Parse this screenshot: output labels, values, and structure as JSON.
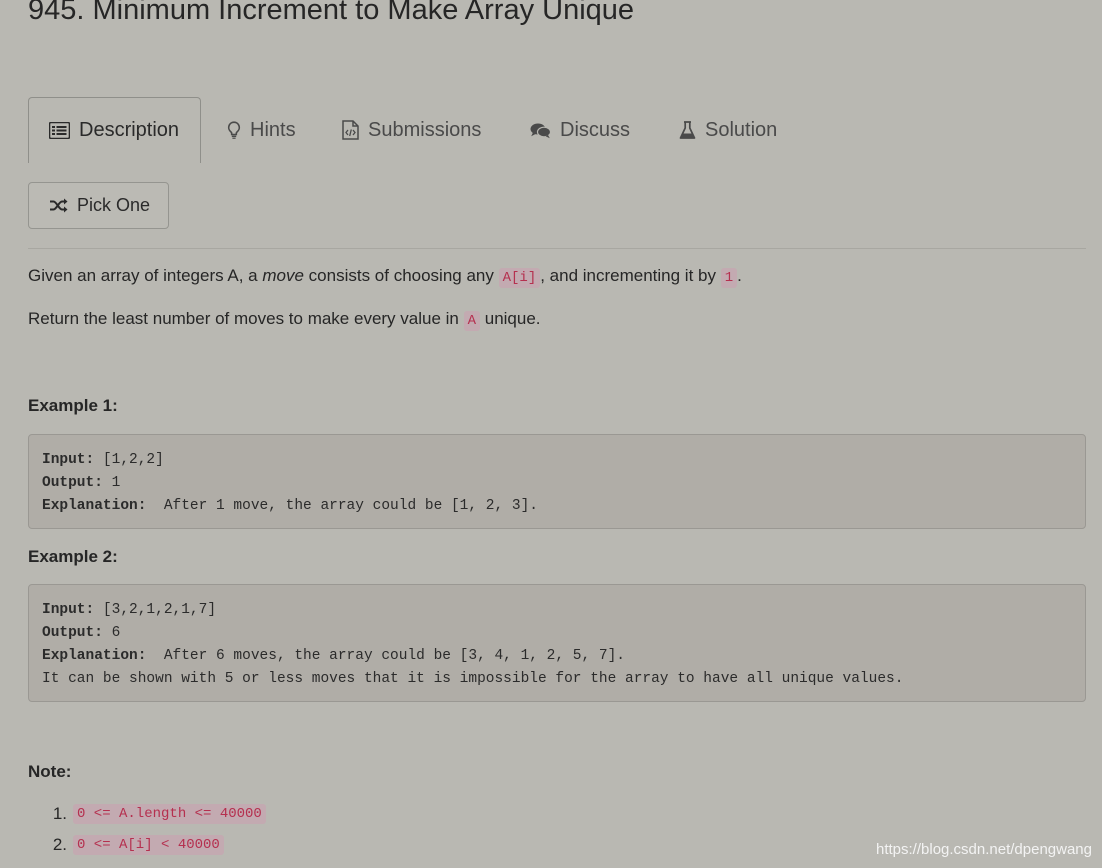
{
  "problem": {
    "title": "945. Minimum Increment to Make Array Unique"
  },
  "tabs": [
    {
      "label": "Description",
      "icon": "list-icon",
      "active": true
    },
    {
      "label": "Hints",
      "icon": "lightbulb-icon",
      "active": false
    },
    {
      "label": "Submissions",
      "icon": "code-file-icon",
      "active": false
    },
    {
      "label": "Discuss",
      "icon": "comments-icon",
      "active": false
    },
    {
      "label": "Solution",
      "icon": "flask-icon",
      "active": false
    }
  ],
  "pick_one": {
    "label": "Pick One",
    "icon": "shuffle-icon"
  },
  "description": {
    "line1_a": "Given an array of integers A, a ",
    "line1_em": "move",
    "line1_b": " consists of choosing any ",
    "line1_code1": "A[i]",
    "line1_c": ", and incrementing it by ",
    "line1_code2": "1",
    "line1_d": ".",
    "line2_a": "Return the least number of moves to make every value in ",
    "line2_code": "A",
    "line2_b": " unique."
  },
  "examples": [
    {
      "heading": "Example 1:",
      "input_label": "Input:",
      "input_value": " [1,2,2]",
      "output_label": "Output:",
      "output_value": " 1",
      "explanation_label": "Explanation:",
      "explanation_value": "  After 1 move, the array could be [1, 2, 3].",
      "extra": ""
    },
    {
      "heading": "Example 2:",
      "input_label": "Input:",
      "input_value": " [3,2,1,2,1,7]",
      "output_label": "Output:",
      "output_value": " 6",
      "explanation_label": "Explanation:",
      "explanation_value": "  After 6 moves, the array could be [3, 4, 1, 2, 5, 7].",
      "extra": "It can be shown with 5 or less moves that it is impossible for the array to have all unique values."
    }
  ],
  "note": {
    "heading": "Note:",
    "items": [
      {
        "num": "1.",
        "code": "0 <= A.length <= 40000"
      },
      {
        "num": "2.",
        "code": "0 <= A[i] < 40000"
      }
    ]
  },
  "watermark": "https://blog.csdn.net/dpengwang",
  "colors": {
    "background": "#b9b8b2",
    "code_text": "#b5304f",
    "code_bg": "#c3aab1",
    "pre_bg": "#b0ada7"
  }
}
